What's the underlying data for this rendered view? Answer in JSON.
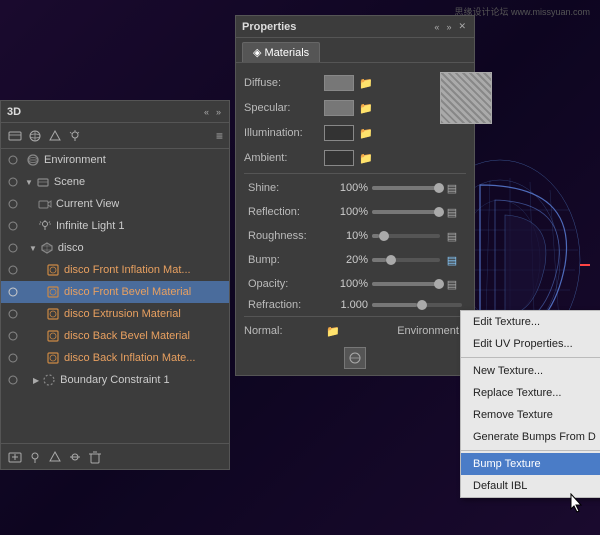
{
  "watermark": "思缘设计论坛 www.missyuan.com",
  "scene3d": {
    "label": "3D scene background"
  },
  "panel3d": {
    "title": "3D",
    "controls": [
      "<<",
      ">>"
    ],
    "toolbar_icons": [
      "layers",
      "scene",
      "mesh",
      "environment",
      "light"
    ],
    "layers": [
      {
        "id": "env",
        "name": "Environment",
        "level": 0,
        "icon": "globe",
        "visible": true,
        "expanded": false
      },
      {
        "id": "scene",
        "name": "Scene",
        "level": 0,
        "icon": "box",
        "visible": true,
        "expanded": true
      },
      {
        "id": "current_view",
        "name": "Current View",
        "level": 1,
        "icon": "camera",
        "visible": true
      },
      {
        "id": "inf_light",
        "name": "Infinite Light 1",
        "level": 1,
        "icon": "sun",
        "visible": true
      },
      {
        "id": "disco",
        "name": "disco",
        "level": 1,
        "icon": "mesh",
        "visible": true,
        "expanded": true
      },
      {
        "id": "mat1",
        "name": "disco Front Inflation Mat...",
        "level": 2,
        "icon": "material",
        "visible": true,
        "orange": true
      },
      {
        "id": "mat2",
        "name": "disco Front Bevel Material",
        "level": 2,
        "icon": "material",
        "visible": true,
        "selected": true,
        "orange": true
      },
      {
        "id": "mat3",
        "name": "disco Extrusion Material",
        "level": 2,
        "icon": "material",
        "visible": true,
        "orange": true
      },
      {
        "id": "mat4",
        "name": "disco Back Bevel Material",
        "level": 2,
        "icon": "material",
        "visible": true,
        "orange": true
      },
      {
        "id": "mat5",
        "name": "disco Back Inflation Mate...",
        "level": 2,
        "icon": "material",
        "visible": true,
        "orange": true
      },
      {
        "id": "boundary",
        "name": "Boundary Constraint 1",
        "level": 1,
        "icon": "constraint",
        "visible": true,
        "expanded": false
      }
    ],
    "bottom_icons": [
      "add",
      "light",
      "mesh",
      "constraint",
      "delete"
    ]
  },
  "properties": {
    "title": "Properties",
    "controls": [
      "<<",
      ">>",
      "x"
    ],
    "tabs": [
      {
        "label": "Materials",
        "active": true,
        "icon": "◈"
      }
    ],
    "diffuse": {
      "label": "Diffuse:",
      "color": "#666666"
    },
    "specular": {
      "label": "Specular:",
      "color": "#666666"
    },
    "illumination": {
      "label": "Illumination:",
      "color": "#333333"
    },
    "ambient": {
      "label": "Ambient:",
      "color": "#333333"
    },
    "sliders": [
      {
        "label": "Shine:",
        "value": "100%",
        "fill": 1.0
      },
      {
        "label": "Reflection:",
        "value": "100%",
        "fill": 1.0
      },
      {
        "label": "Roughness:",
        "value": "10%",
        "fill": 0.1
      },
      {
        "label": "Bump:",
        "value": "20%",
        "fill": 0.2
      },
      {
        "label": "Opacity:",
        "value": "100%",
        "fill": 1.0
      },
      {
        "label": "Refraction:",
        "value": "1.000",
        "fill": 0.5
      }
    ],
    "normal_label": "Normal:",
    "environment_label": "Environment:"
  },
  "context_menu": {
    "items": [
      {
        "id": "edit_texture",
        "label": "Edit Texture...",
        "disabled": false
      },
      {
        "id": "edit_uv",
        "label": "Edit UV Properties...",
        "disabled": false
      },
      {
        "id": "sep1",
        "type": "divider"
      },
      {
        "id": "new_texture",
        "label": "New Texture...",
        "disabled": false
      },
      {
        "id": "replace_texture",
        "label": "Replace Texture...",
        "disabled": false
      },
      {
        "id": "remove_texture",
        "label": "Remove Texture",
        "disabled": false
      },
      {
        "id": "gen_bumps",
        "label": "Generate Bumps From D",
        "disabled": false
      },
      {
        "id": "sep2",
        "type": "divider"
      },
      {
        "id": "bump_texture",
        "label": "Bump Texture",
        "disabled": false,
        "highlighted": true
      },
      {
        "id": "default_ibl",
        "label": "Default IBL",
        "disabled": false
      }
    ]
  }
}
